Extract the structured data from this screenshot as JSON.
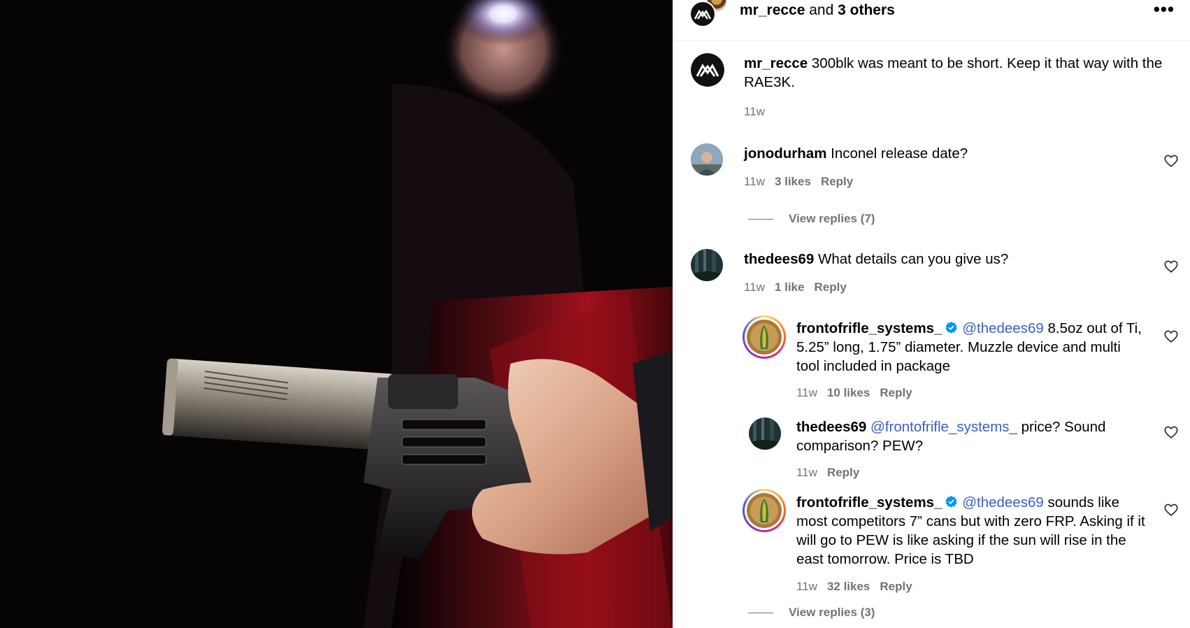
{
  "header": {
    "username": "mr_recce",
    "and_text": " and ",
    "others": "3 others",
    "more_label": "•••"
  },
  "caption": {
    "username": "mr_recce",
    "text": " 300blk was meant to be short. Keep it that way with the RAE3K.",
    "time": "11w"
  },
  "comments": [
    {
      "username": "jonodurham",
      "text": " Inconel release date?",
      "time": "11w",
      "likes": "3 likes",
      "reply": "Reply",
      "view_replies": "View replies (7)"
    },
    {
      "username": "thedees69",
      "text": " What details can you give us?",
      "time": "11w",
      "likes": "1 like",
      "reply": "Reply",
      "replies": [
        {
          "username": "frontofrifle_systems_",
          "mention": "@thedees69",
          "text": " 8.5oz out of Ti, 5.25” long, 1.75” diameter. Muzzle device and multi tool included in package",
          "time": "11w",
          "likes": "10 likes",
          "reply": "Reply"
        },
        {
          "username": "thedees69",
          "mention": "@frontofrifle_systems_",
          "text": " price? Sound comparison? PEW?",
          "time": "11w",
          "reply": "Reply"
        },
        {
          "username": "frontofrifle_systems_",
          "mention": "@thedees69",
          "text": " sounds like most competitors 7” cans but with zero FRP. Asking if it will go to PEW is like asking if the sun will rise in the east tomorrow. Price is TBD",
          "time": "11w",
          "likes": "32 likes",
          "reply": "Reply"
        }
      ],
      "view_replies": "View replies (3)"
    }
  ],
  "colors": {
    "mention": "#3b5fc4",
    "meta": "#737373",
    "verified": "#0095f6"
  }
}
